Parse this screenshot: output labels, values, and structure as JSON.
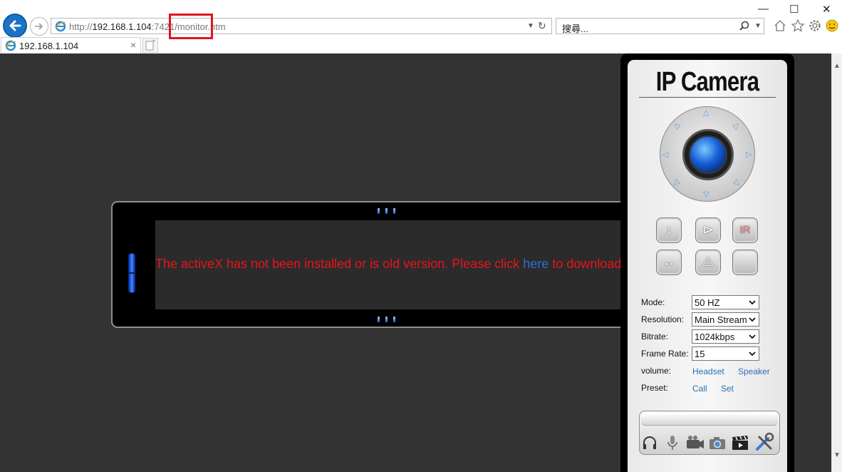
{
  "browser": {
    "url_prefix": "http://",
    "url_host": "192.168.1.104",
    "url_rest": ":7421/monitor.htm",
    "search_placeholder": "搜尋...",
    "tab_title": "192.168.1.104",
    "tab_close": "×",
    "window_controls": {
      "minimize": "—",
      "maximize": "☐",
      "close": "✕"
    },
    "icons": [
      "back-icon",
      "forward-icon",
      "ie-icon",
      "refresh-icon",
      "search-icon",
      "home-icon",
      "favorites-star-icon",
      "settings-gear-icon",
      "smiley-feedback-icon",
      "new-tab-icon"
    ],
    "highlight_color": "#e0141e"
  },
  "video": {
    "message_before": "The activeX has not been installed or is old version. Please click ",
    "message_link": "here",
    "message_after": " to download",
    "message_color": "#e8141c",
    "link_color": "#2a6fd6"
  },
  "panel": {
    "brand": "IP Camera",
    "ptz_icons": [
      "up-arrow-icon",
      "down-arrow-icon",
      "left-arrow-icon",
      "right-arrow-icon",
      "up-left-arrow-icon",
      "up-right-arrow-icon",
      "down-left-arrow-icon",
      "down-right-arrow-icon"
    ],
    "buttons": [
      {
        "name": "flip-vertical-button",
        "glyph": "↕"
      },
      {
        "name": "mirror-button",
        "glyph": "⊳"
      },
      {
        "name": "ir-button",
        "glyph": "IR"
      },
      {
        "name": "flip-horizontal-button",
        "glyph": "↔"
      },
      {
        "name": "mirror-warning-button",
        "glyph": "⚠"
      },
      {
        "name": "blank-button",
        "glyph": ""
      }
    ],
    "mode_label": "Mode:",
    "mode_value": "50 HZ",
    "resolution_label": "Resolution:",
    "resolution_value": "Main Stream",
    "bitrate_label": "Bitrate:",
    "bitrate_value": "1024kbps",
    "framerate_label": "Frame Rate:",
    "framerate_value": "15",
    "volume_label": "volume:",
    "headset_link": "Headset",
    "speaker_link": "Speaker",
    "preset_label": "Preset:",
    "call_link": "Call",
    "set_link": "Set",
    "bottom_icons": [
      "headphones-icon",
      "microphone-icon",
      "video-record-icon",
      "snapshot-camera-icon",
      "clapperboard-icon",
      "tools-settings-icon"
    ]
  }
}
